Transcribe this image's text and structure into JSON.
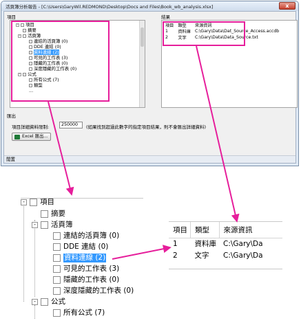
{
  "dialog": {
    "title": "活頁簿分析報告 - [C:\\Users\\GaryWil.REDMOND\\Desktop\\Docs and Files\\Book_wb_analysis.xlsx]",
    "close_glyph": "x",
    "items_group_label": "項目",
    "results_group_label": "結果",
    "output_group_label": "匯出",
    "detail_limit_label": "項目詳細資料限制:",
    "detail_limit_value": "250000",
    "detail_limit_hint": "(如果找到超過此數字的指定項目結果，則不會匯出詳細資料)",
    "excel_export_label": "Excel 匯出...",
    "status_text": "閒置"
  },
  "tree": {
    "root": "項目",
    "summary": "摘要",
    "workbook": "活頁簿",
    "linked_workbooks": "連結的活頁簿 (0)",
    "dde_links": "DDE 連結 (0)",
    "data_links": "資料連線 (2)",
    "visible_sheets": "可見的工作表 (3)",
    "hidden_sheets": "隱藏的工作表 (0)",
    "very_hidden_sheets": "深度隱藏的工作表 (0)",
    "formulas": "公式",
    "all_formulas": "所有公式 (7)",
    "formula_item_cut": "類型",
    "formula_item_cut2": "..."
  },
  "results": {
    "headers": [
      "項目",
      "類型",
      "來源資訊"
    ],
    "rows": [
      [
        "1",
        "資料庫",
        "C:\\Gary\\Data\\Dat_Source_Access.accdb"
      ],
      [
        "2",
        "文字",
        "C:\\Gary\\Data\\Data_Source.txt"
      ]
    ],
    "zoom_rows": [
      [
        "1",
        "資料庫",
        "C:\\Gary\\Da"
      ],
      [
        "2",
        "文字",
        "C:\\Gary\\Da"
      ]
    ]
  },
  "colors": {
    "highlight": "#e61e9b",
    "selection": "#3399ff"
  }
}
